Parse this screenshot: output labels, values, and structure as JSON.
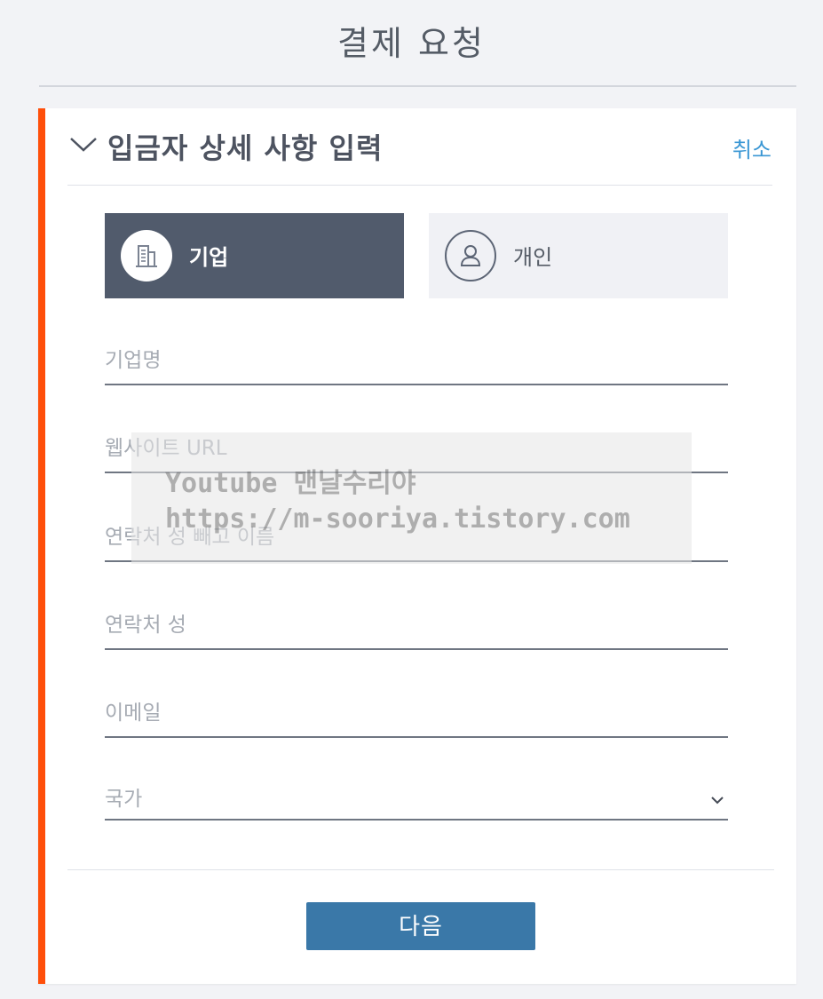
{
  "page": {
    "title": "결제 요청"
  },
  "section": {
    "title": "입금자 상세 사항 입력",
    "cancel_label": "취소"
  },
  "customer_type": {
    "company_label": "기업",
    "personal_label": "개인",
    "selected": "기업",
    "company_icon": "building-icon",
    "personal_icon": "person-icon"
  },
  "fields": [
    {
      "placeholder": "기업명"
    },
    {
      "placeholder": "웹사이트 URL"
    },
    {
      "placeholder": "연락처 성 빼고 이름"
    },
    {
      "placeholder": "연락처 성"
    },
    {
      "placeholder": "이메일"
    }
  ],
  "country_select": {
    "label": "국가"
  },
  "next_label": "다음",
  "watermark": {
    "line1": "Youtube 맨날수리야",
    "line2": "https://m-sooriya.tistory.com"
  },
  "colors": {
    "accent_bar": "#ff4f0a",
    "selected_type_bg": "#515b6c",
    "next_button": "#3a78a8",
    "link": "#3a97d4"
  }
}
